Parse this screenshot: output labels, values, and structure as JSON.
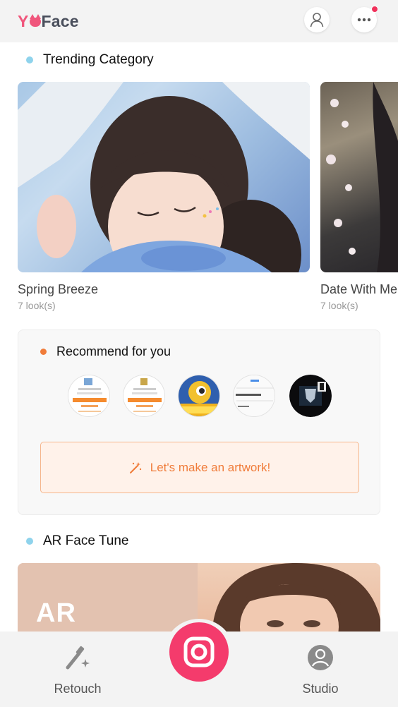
{
  "header": {
    "logo_part1": "Y",
    "logo_part2": "Face",
    "icons": [
      "profile-icon",
      "more-icon"
    ],
    "notification_dot_color": "#f0315b"
  },
  "trending": {
    "title": "Trending Category",
    "bullet_color": "#8fd3ec",
    "cards": [
      {
        "name": "Spring Breeze",
        "count": "7 look(s)"
      },
      {
        "name": "Date With Me",
        "count": "7 look(s)"
      }
    ]
  },
  "recommend": {
    "title": "Recommend for you",
    "bullet_color": "#f07c3a",
    "avatars": [
      "app-screenshot-avatar",
      "app-screenshot-avatar",
      "game-avatar",
      "input-screenshot-avatar",
      "character-avatar"
    ],
    "action_label": "Let's make an artwork!",
    "accent_color": "#f07c3a"
  },
  "ar": {
    "title": "AR Face Tune",
    "bullet_color": "#8fd3ec",
    "badge": "AR"
  },
  "bottom_nav": {
    "retouch_label": "Retouch",
    "studio_label": "Studio",
    "camera_color": "#f43b6c"
  }
}
